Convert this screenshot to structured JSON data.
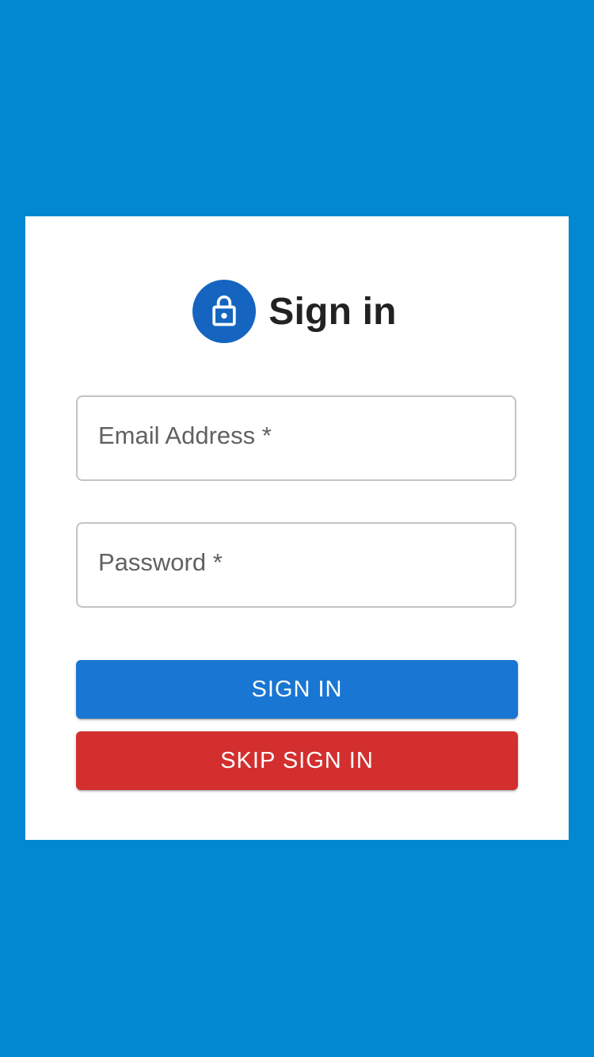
{
  "header": {
    "icon": "lock-icon",
    "title": "Sign in"
  },
  "form": {
    "email_placeholder": "Email Address *",
    "email_value": "",
    "password_placeholder": "Password *",
    "password_value": ""
  },
  "buttons": {
    "sign_in_label": "SIGN IN",
    "skip_label": "SKIP SIGN IN"
  },
  "colors": {
    "background": "#0288d1",
    "avatar": "#1565c0",
    "primary": "#1976d2",
    "error": "#d32f2f"
  }
}
